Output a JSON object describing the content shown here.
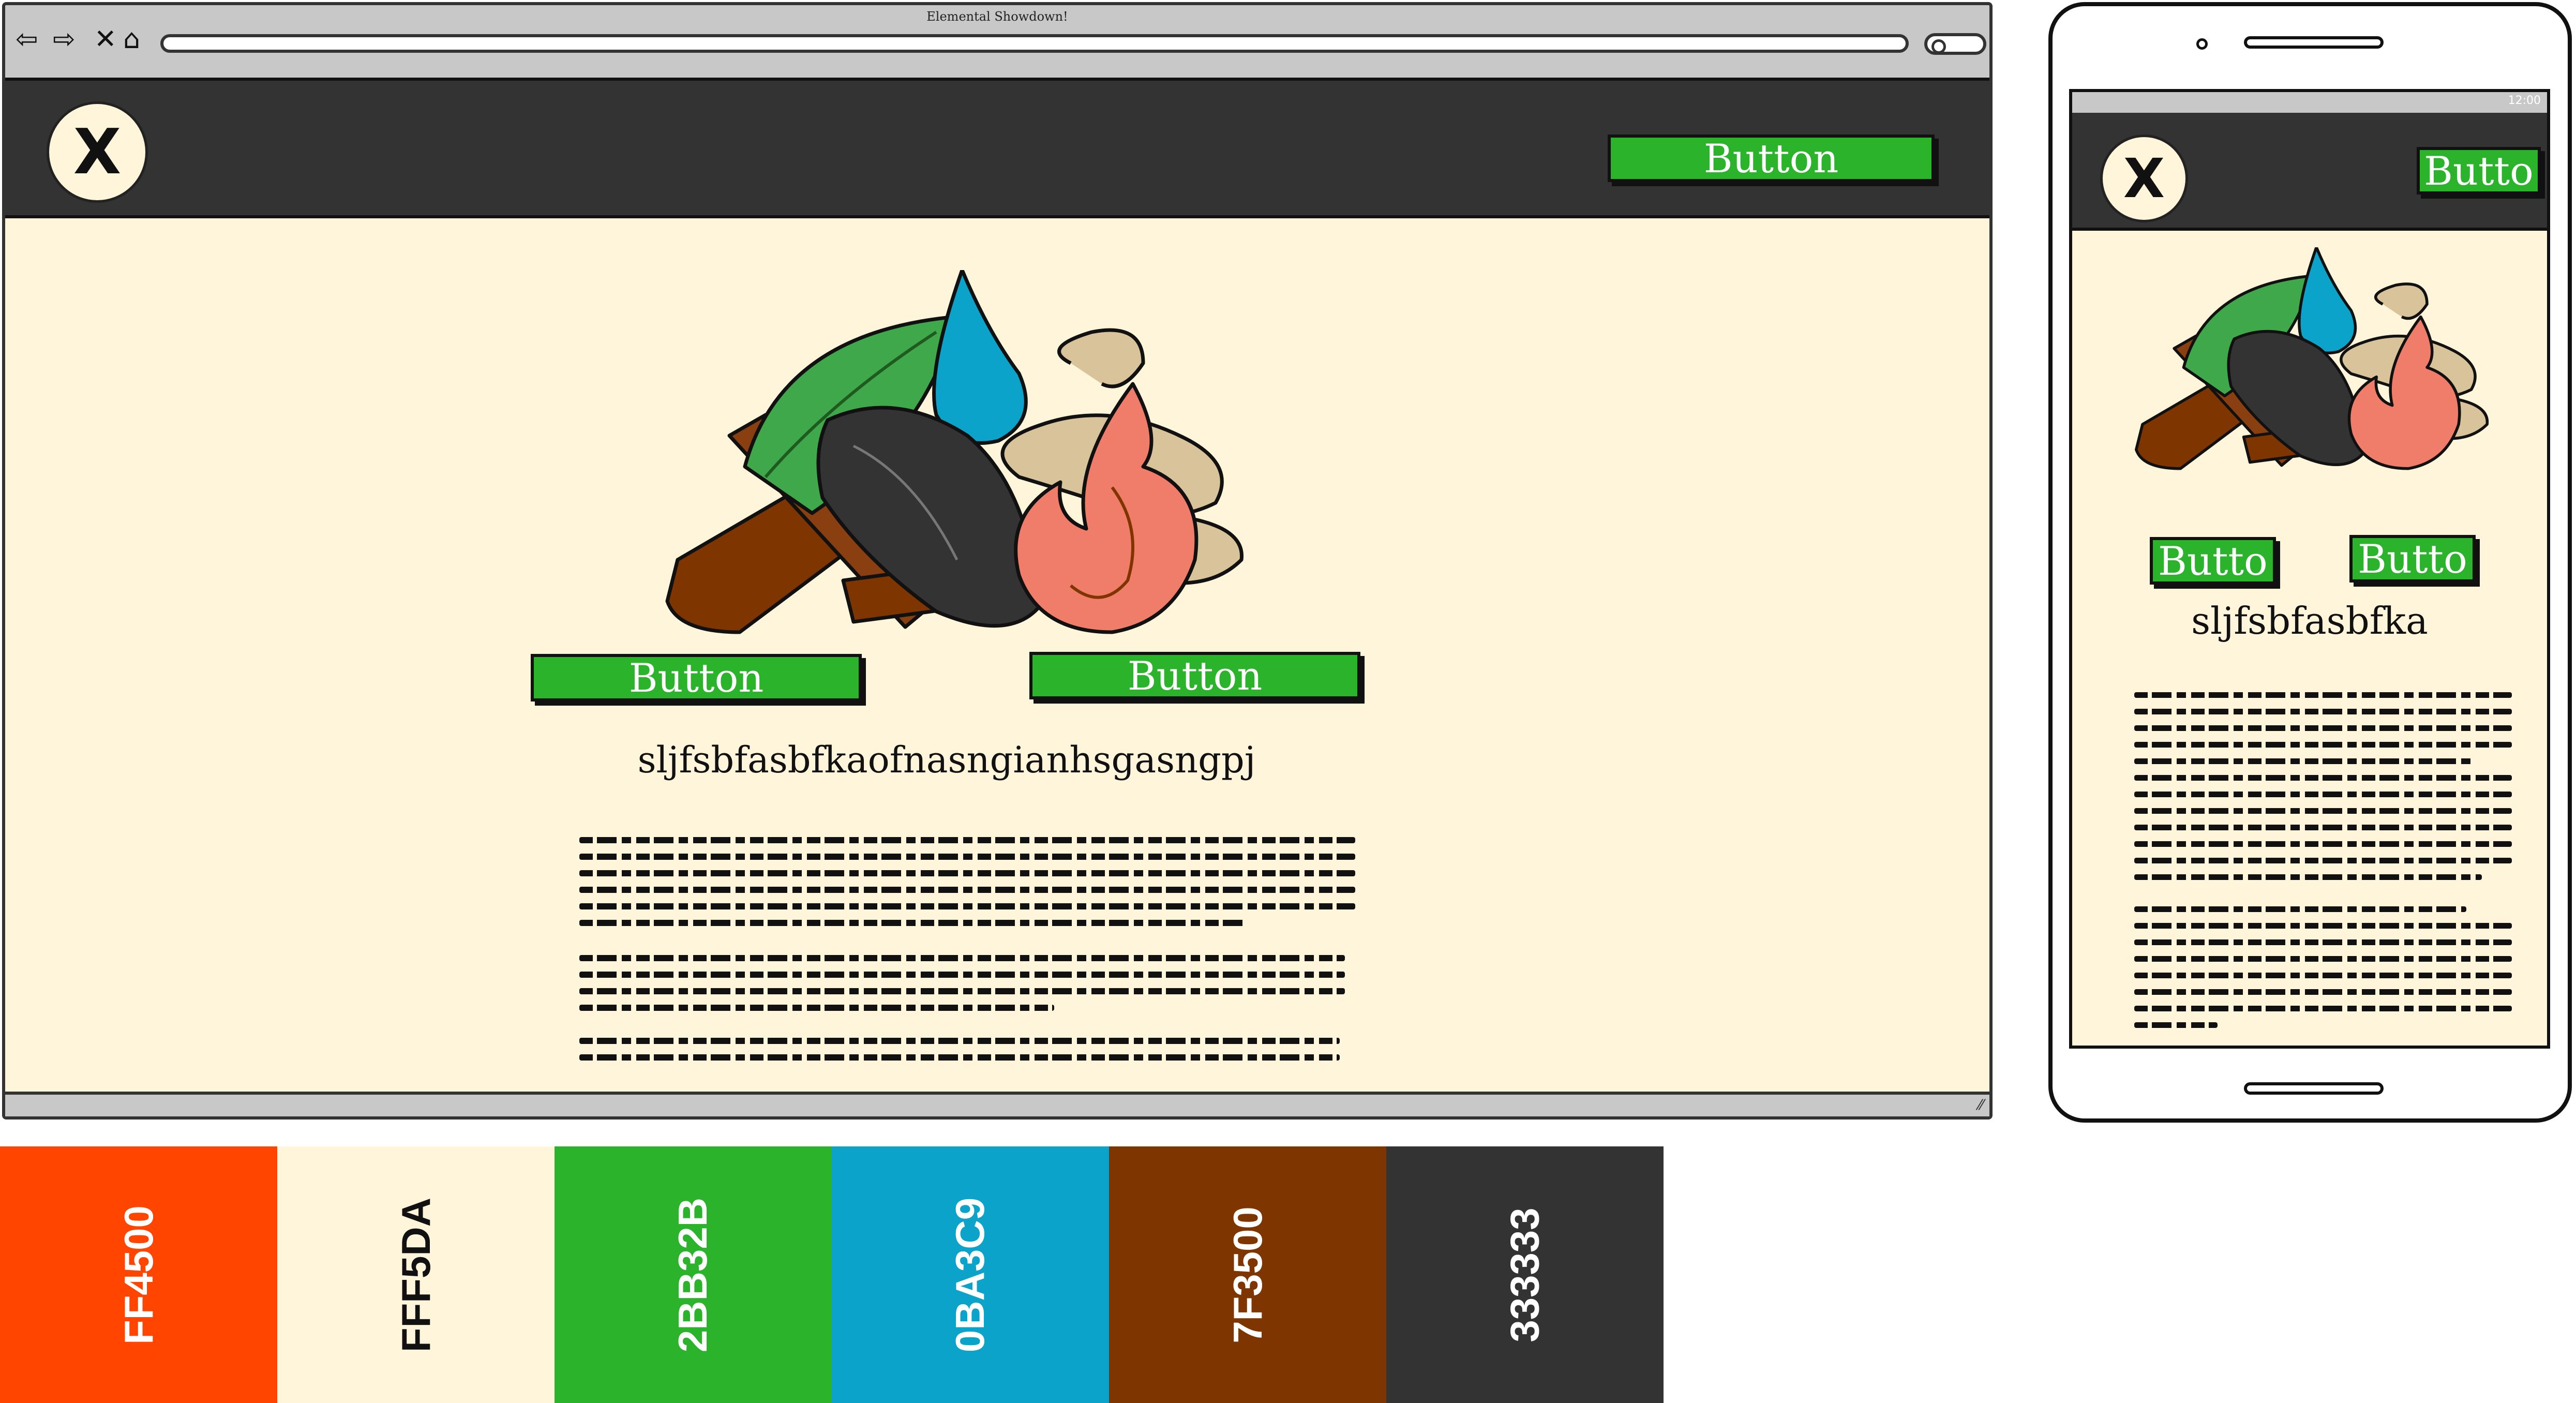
{
  "browser": {
    "title": "Elemental Showdown!",
    "nav_icons": [
      "back-arrow-icon",
      "forward-arrow-icon",
      "close-icon",
      "home-icon"
    ],
    "nav_glyphs": [
      "⇦",
      "⇨",
      "✕",
      "⌂"
    ],
    "resize_glyph": "⁄⁄"
  },
  "desktop": {
    "logo_glyph": "X",
    "header_button_label": "Button",
    "hero_buttons": [
      "Button",
      "Button"
    ],
    "heading": "sljfsbfasbfkaofnasngianhsgasngpj"
  },
  "mobile": {
    "status_text": "12:00",
    "logo_glyph": "X",
    "header_button_label": "Butto",
    "hero_buttons": [
      "Butto",
      "Butto"
    ],
    "heading": "sljfsbfasbfka"
  },
  "palette": [
    {
      "hex": "FF4500",
      "color": "#FF4500",
      "text_color": "#ffffff"
    },
    {
      "hex": "FFF5DA",
      "color": "#FFF5DA",
      "text_color": "#111111"
    },
    {
      "hex": "2BB32B",
      "color": "#2BB32B",
      "text_color": "#ffffff"
    },
    {
      "hex": "0BA3C9",
      "color": "#0BA3C9",
      "text_color": "#ffffff"
    },
    {
      "hex": "7F3500",
      "color": "#7F3500",
      "text_color": "#ffffff"
    },
    {
      "hex": "333333",
      "color": "#333333",
      "text_color": "#ffffff"
    }
  ],
  "colors": {
    "accent": "#2BB32B",
    "background": "#FFF5DA",
    "header": "#333333",
    "fire": "#FF4500",
    "water": "#0BA3C9",
    "wood": "#7F3500"
  }
}
